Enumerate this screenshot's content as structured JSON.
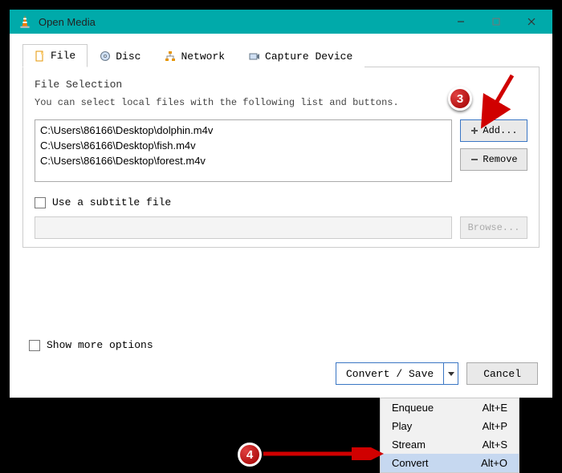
{
  "window": {
    "title": "Open Media"
  },
  "tabs": [
    {
      "label": "File"
    },
    {
      "label": "Disc"
    },
    {
      "label": "Network"
    },
    {
      "label": "Capture Device"
    }
  ],
  "file_section": {
    "label": "File Selection",
    "desc": "You can select local files with the following list and buttons.",
    "files": [
      "C:\\Users\\86166\\Desktop\\dolphin.m4v",
      "C:\\Users\\86166\\Desktop\\fish.m4v",
      "C:\\Users\\86166\\Desktop\\forest.m4v"
    ],
    "add_label": "Add...",
    "remove_label": "Remove"
  },
  "subtitle": {
    "label": "Use a subtitle file",
    "browse_label": "Browse..."
  },
  "more_options_label": "Show more options",
  "footer": {
    "convert_label": "Convert / Save",
    "cancel_label": "Cancel"
  },
  "menu": [
    {
      "label": "Enqueue",
      "shortcut": "Alt+E"
    },
    {
      "label": "Play",
      "shortcut": "Alt+P"
    },
    {
      "label": "Stream",
      "shortcut": "Alt+S"
    },
    {
      "label": "Convert",
      "shortcut": "Alt+O"
    }
  ],
  "callouts": {
    "three": "3",
    "four": "4"
  }
}
